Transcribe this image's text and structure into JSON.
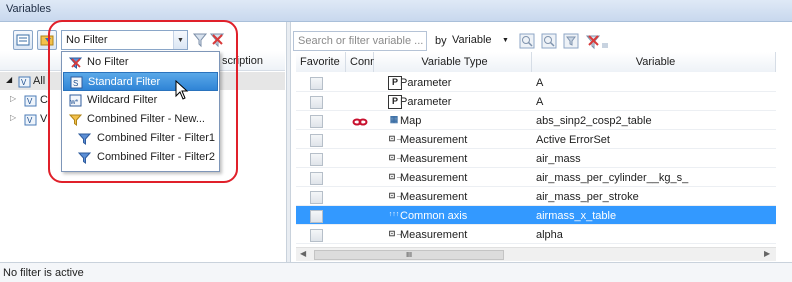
{
  "window": {
    "title": "Variables"
  },
  "left_toolbar": {
    "filter_combo_value": "No Filter"
  },
  "left_panel": {
    "header_partial": "scription",
    "tree": [
      {
        "label": "All",
        "expanded": true
      },
      {
        "label": "C",
        "expanded": false
      },
      {
        "label": "V",
        "expanded": false
      }
    ]
  },
  "filter_dropdown": {
    "items": [
      {
        "label": "No Filter",
        "icon": "no-filter-icon",
        "highlighted": false
      },
      {
        "label": "Standard Filter",
        "icon": "standard-filter-icon",
        "highlighted": true
      },
      {
        "label": "Wildcard Filter",
        "icon": "wildcard-filter-icon",
        "highlighted": false
      },
      {
        "label": "Combined Filter - New...",
        "icon": "combined-filter-icon",
        "highlighted": false
      },
      {
        "label": "Combined Filter - Filter1",
        "icon": "combined-filter-icon",
        "highlighted": false
      },
      {
        "label": "Combined Filter - Filter2",
        "icon": "combined-filter-icon",
        "highlighted": false
      }
    ]
  },
  "right_toolbar": {
    "search_placeholder": "Search or filter variable ...",
    "by_label": "by",
    "by_value": "Variable"
  },
  "table": {
    "columns": [
      "Favorite",
      "Conn",
      "Variable Type",
      "Variable"
    ],
    "rows": [
      {
        "type_icon": "P",
        "type": "Parameter",
        "variable": "A",
        "conn": ""
      },
      {
        "type_icon": "P",
        "type": "Parameter",
        "variable": "A",
        "conn": ""
      },
      {
        "type_icon": "map",
        "type": "Map",
        "variable": "abs_sinp2_cosp2_table",
        "conn": "link"
      },
      {
        "type_icon": "meas",
        "type": "Measurement",
        "variable": "Active ErrorSet",
        "conn": ""
      },
      {
        "type_icon": "meas",
        "type": "Measurement",
        "variable": "air_mass",
        "conn": ""
      },
      {
        "type_icon": "meas",
        "type": "Measurement",
        "variable": "air_mass_per_cylinder__kg_s_",
        "conn": ""
      },
      {
        "type_icon": "meas",
        "type": "Measurement",
        "variable": "air_mass_per_stroke",
        "conn": ""
      },
      {
        "type_icon": "axis",
        "type": "Common axis",
        "variable": "airmass_x_table",
        "conn": "",
        "selected": true
      },
      {
        "type_icon": "meas",
        "type": "Measurement",
        "variable": "alpha",
        "conn": ""
      }
    ]
  },
  "scrollbar": {
    "grip": "III"
  },
  "status": {
    "text": "No filter is active"
  },
  "colors": {
    "selection": "#3399ff",
    "annotation_frame": "#e0202a",
    "header": "#c8d8ee"
  }
}
